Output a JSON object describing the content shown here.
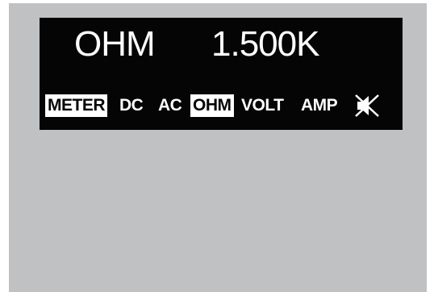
{
  "display": {
    "mode": "OHM",
    "value": "1.500K"
  },
  "mode_buttons": [
    {
      "label": "METER",
      "active": true
    },
    {
      "label": "DC",
      "active": false
    },
    {
      "label": "AC",
      "active": false
    },
    {
      "label": "OHM",
      "active": true
    },
    {
      "label": "VOLT",
      "active": false
    },
    {
      "label": "AMP",
      "active": false
    }
  ],
  "icons": {
    "sound": "speaker-muted-icon"
  },
  "colors": {
    "panel_background": "#c0c1c3",
    "display_background": "#050505",
    "text": "#ffffff"
  }
}
